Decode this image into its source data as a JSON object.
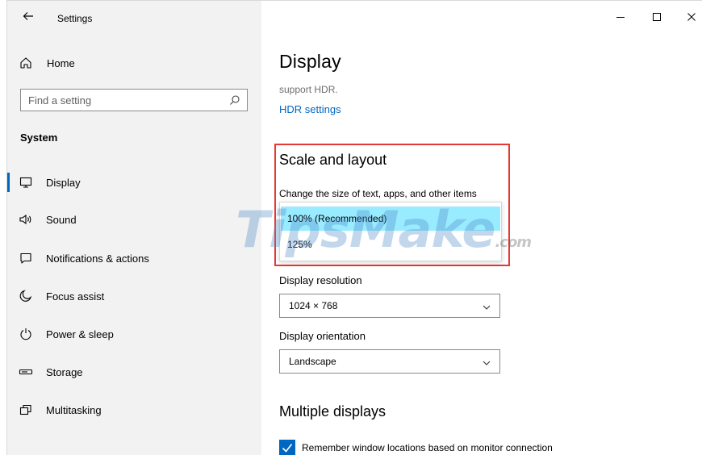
{
  "window": {
    "title": "Settings",
    "controls": [
      "minimize",
      "maximize",
      "close"
    ]
  },
  "sidebar": {
    "home_label": "Home",
    "search_placeholder": "Find a setting",
    "section_title": "System",
    "items": [
      {
        "label": "Display",
        "icon": "monitor-icon",
        "active": true
      },
      {
        "label": "Sound",
        "icon": "speaker-icon",
        "active": false
      },
      {
        "label": "Notifications & actions",
        "icon": "notification-icon",
        "active": false
      },
      {
        "label": "Focus assist",
        "icon": "moon-icon",
        "active": false
      },
      {
        "label": "Power & sleep",
        "icon": "power-icon",
        "active": false
      },
      {
        "label": "Storage",
        "icon": "storage-icon",
        "active": false
      },
      {
        "label": "Multitasking",
        "icon": "multitasking-icon",
        "active": false
      }
    ]
  },
  "main": {
    "title": "Display",
    "hdr_text": "support HDR.",
    "hdr_link": "HDR settings",
    "scale": {
      "title": "Scale and layout",
      "description": "Change the size of text, apps, and other items",
      "options": [
        "100% (Recommended)",
        "125%"
      ],
      "selected_index": 0
    },
    "resolution": {
      "label": "Display resolution",
      "value": "1024 × 768"
    },
    "orientation": {
      "label": "Display orientation",
      "value": "Landscape"
    },
    "multiple_displays": {
      "title": "Multiple displays",
      "remember_label": "Remember window locations based on monitor connection",
      "remember_checked": true
    }
  },
  "watermark": {
    "main": "TipsMake",
    "suffix": ".com"
  },
  "colors": {
    "accent": "#0067c0",
    "highlight_border": "#e53935",
    "selected_option": "#99ebff",
    "sidebar_bg": "#f2f2f2"
  }
}
